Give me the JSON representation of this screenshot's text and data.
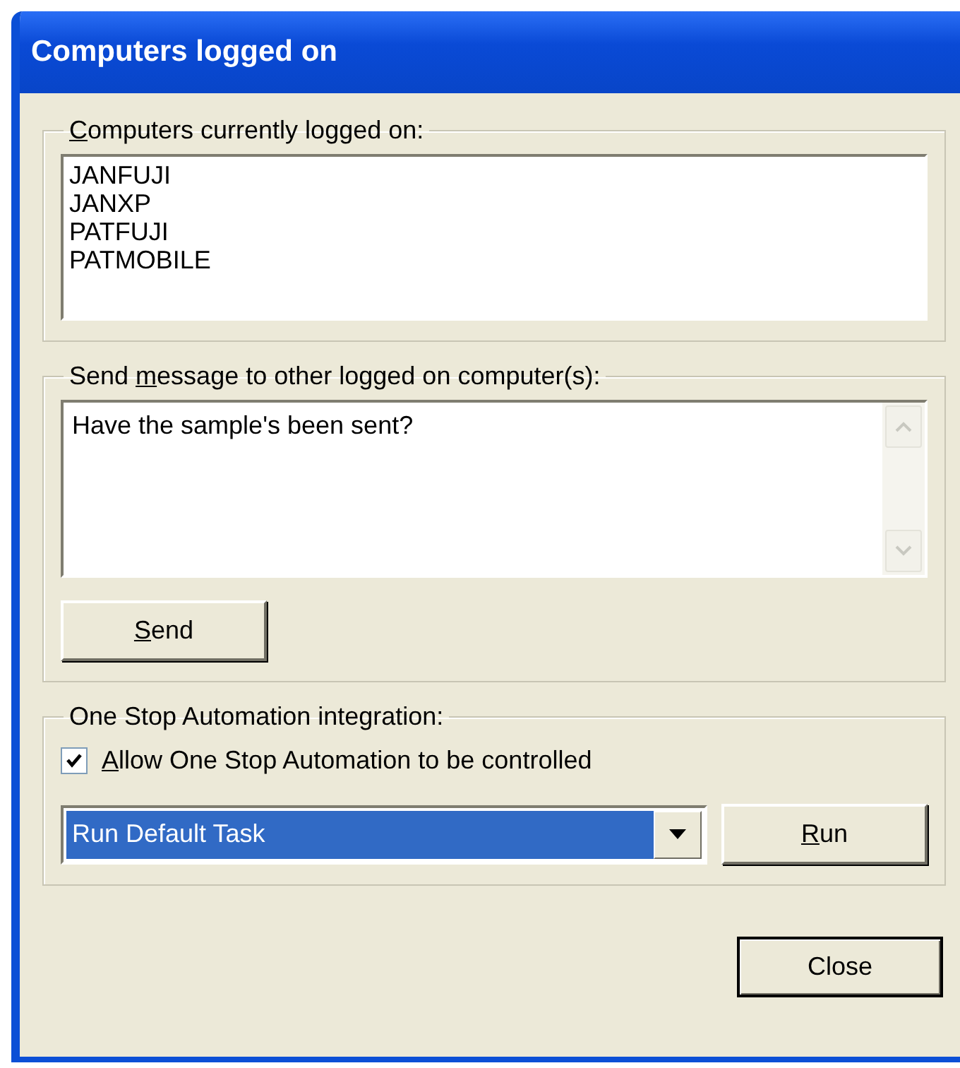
{
  "window": {
    "title": "Computers logged on"
  },
  "computers_group": {
    "label": "Computers currently logged on:",
    "items": [
      "JANFUJI",
      "JANXP",
      "PATFUJI",
      "PATMOBILE"
    ]
  },
  "message_group": {
    "label": "Send message to other logged on computer(s):",
    "value": "Have the sample's been sent?",
    "send_button": {
      "label": "Send"
    }
  },
  "automation_group": {
    "label": "One Stop Automation integration:",
    "checkbox": {
      "label": "Allow One Stop Automation to be controlled",
      "checked": true
    },
    "task_select": {
      "value": "Run Default Task"
    },
    "run_button": {
      "label": "Run"
    }
  },
  "close_button": {
    "label": "Close"
  }
}
